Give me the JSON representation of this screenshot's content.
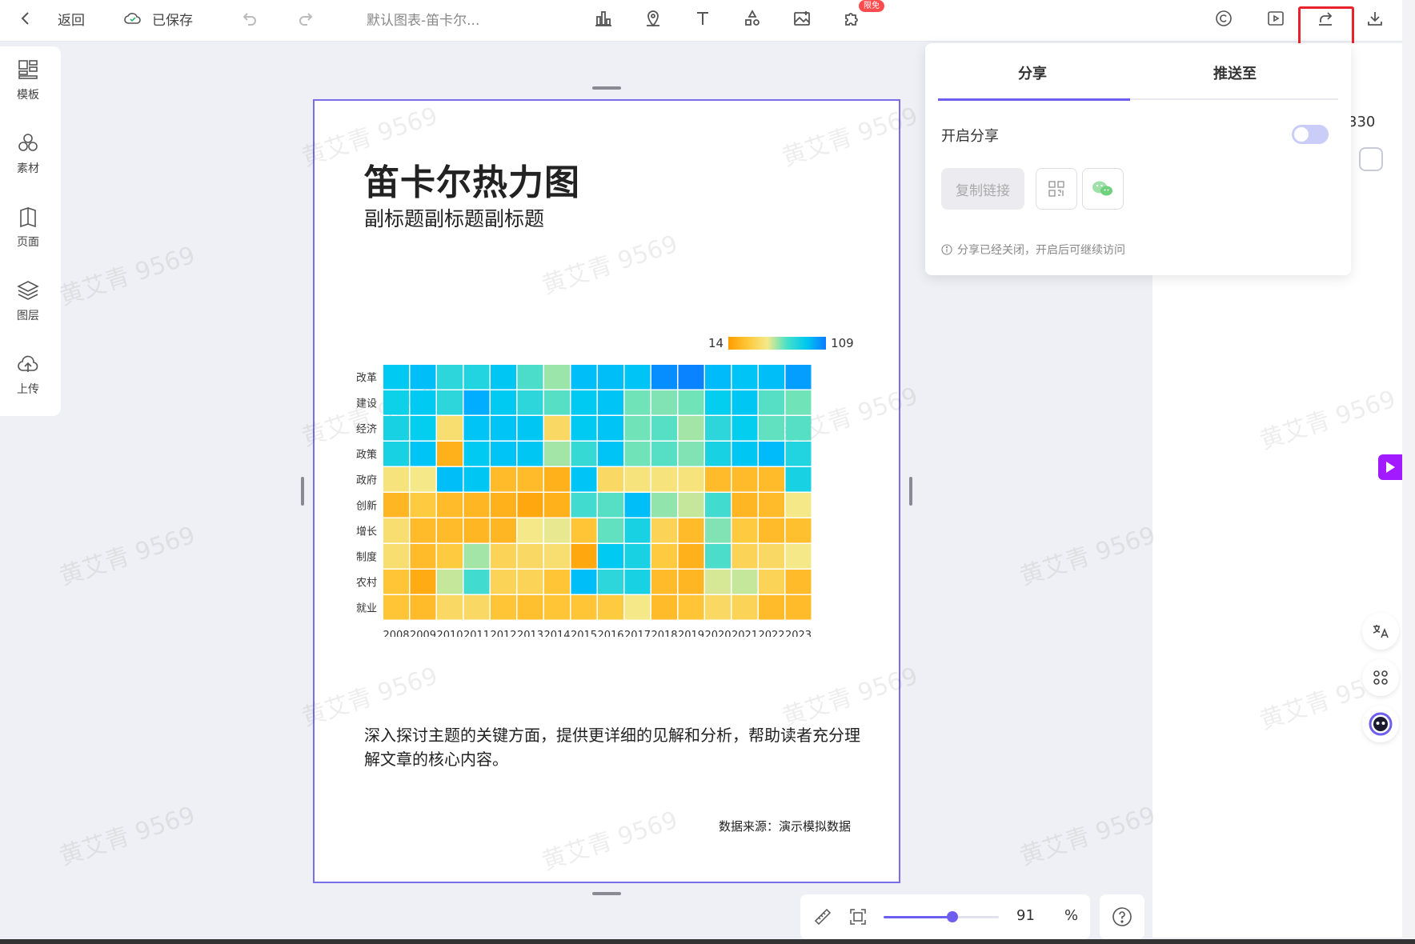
{
  "toolbar": {
    "back_label": "返回",
    "saved_label": "已保存",
    "doc_title": "默认图表-笛卡尔...",
    "badge": "限免"
  },
  "sidebar": {
    "items": [
      {
        "label": "模板",
        "icon": "template-icon"
      },
      {
        "label": "素材",
        "icon": "material-icon"
      },
      {
        "label": "页面",
        "icon": "page-icon"
      },
      {
        "label": "图层",
        "icon": "layers-icon"
      },
      {
        "label": "上传",
        "icon": "upload-cloud-icon"
      }
    ]
  },
  "page": {
    "title": "笛卡尔热力图",
    "subtitle": "副标题副标题副标题",
    "description": "深入探讨主题的关键方面，提供更详细的见解和分析，帮助读者充分理解文章的核心内容。",
    "source": "数据来源：演示模拟数据",
    "watermark": "黄艾青 9569"
  },
  "chart_data": {
    "type": "heatmap",
    "title": "",
    "x": [
      "2008",
      "2009",
      "2010",
      "2011",
      "2012",
      "2013",
      "2014",
      "2015",
      "2016",
      "2017",
      "2018",
      "2019",
      "2020",
      "2021",
      "2022",
      "2023"
    ],
    "y": [
      "改革",
      "建设",
      "经济",
      "政策",
      "政府",
      "创新",
      "增长",
      "制度",
      "农村",
      "就业"
    ],
    "color_min": 14,
    "color_max": 109,
    "values": [
      [
        82,
        88,
        72,
        74,
        84,
        66,
        55,
        88,
        88,
        86,
        104,
        107,
        90,
        86,
        88,
        100
      ],
      [
        78,
        82,
        72,
        96,
        82,
        72,
        64,
        82,
        86,
        60,
        58,
        60,
        80,
        84,
        64,
        60
      ],
      [
        76,
        80,
        40,
        86,
        86,
        84,
        38,
        82,
        86,
        60,
        64,
        54,
        72,
        80,
        62,
        64
      ],
      [
        76,
        86,
        22,
        82,
        86,
        84,
        54,
        70,
        86,
        60,
        64,
        58,
        76,
        84,
        90,
        74
      ],
      [
        42,
        44,
        88,
        84,
        26,
        26,
        22,
        86,
        38,
        42,
        42,
        42,
        26,
        26,
        26,
        76
      ],
      [
        24,
        32,
        26,
        24,
        22,
        18,
        22,
        68,
        64,
        88,
        56,
        50,
        68,
        24,
        26,
        44
      ],
      [
        40,
        26,
        26,
        24,
        24,
        44,
        46,
        30,
        62,
        76,
        36,
        26,
        58,
        32,
        26,
        28
      ],
      [
        40,
        26,
        32,
        54,
        36,
        38,
        40,
        18,
        82,
        76,
        32,
        22,
        66,
        36,
        38,
        44
      ],
      [
        30,
        20,
        50,
        68,
        36,
        36,
        30,
        88,
        72,
        76,
        26,
        24,
        48,
        50,
        36,
        26
      ],
      [
        30,
        26,
        38,
        38,
        30,
        28,
        30,
        30,
        32,
        44,
        26,
        30,
        38,
        36,
        26,
        26
      ]
    ]
  },
  "share_popup": {
    "tabs": [
      "分享",
      "推送至"
    ],
    "enable_share_label": "开启分享",
    "enabled": false,
    "copy_link_label": "复制链接",
    "hint": "分享已经关闭，开启后可继续访问"
  },
  "zoom": {
    "value": "91",
    "unit": "%",
    "level": 0.6
  },
  "right_peek": {
    "number": "330"
  },
  "colors": {
    "accent": "#6d5ef0",
    "highlight": "#e8232b"
  }
}
